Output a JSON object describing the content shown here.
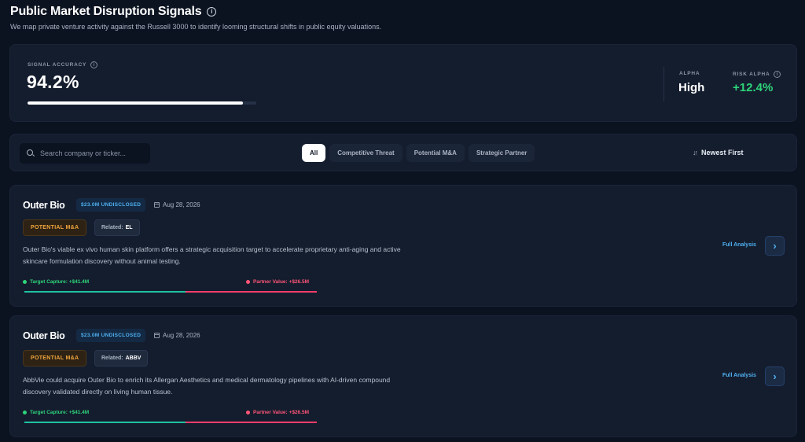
{
  "header": {
    "title": "Public Market Disruption Signals",
    "subtitle": "We map private venture activity against the Russell 3000 to identify looming structural shifts in public equity valuations."
  },
  "stats": {
    "accuracy_label": "SIGNAL ACCURACY",
    "accuracy_value": "94.2%",
    "accuracy_fraction": 0.942,
    "alpha_label": "ALPHA",
    "alpha_value": "High",
    "risk_alpha_label": "RISK ALPHA",
    "risk_alpha_value": "+12.4%",
    "colors": {
      "positive": "#2ed47a"
    }
  },
  "filters": {
    "search_placeholder": "Search company or ticker...",
    "tabs": [
      {
        "label": "All",
        "active": true
      },
      {
        "label": "Competitive Threat",
        "active": false
      },
      {
        "label": "Potential M&A",
        "active": false
      },
      {
        "label": "Strategic Partner",
        "active": false
      }
    ],
    "sort_label": "Newest First",
    "sort_icon": "sort-arrows-icon"
  },
  "signals": [
    {
      "company": "Outer Bio",
      "funding": "$23.0M UNDISCLOSED",
      "date": "Aug 28, 2026",
      "type": "POTENTIAL M&A",
      "related_prefix": "Related:",
      "related_ticker": "EL",
      "description": "Outer Bio's viable ex vivo human skin platform offers a strategic acquisition target to accelerate proprietary anti-aging and active skincare formulation discovery without animal testing.",
      "target_capture": "Target Capture: +$41.4M",
      "partner_value": "Partner Value: +$26.5M",
      "capture_share": 0.55,
      "analysis_label": "Full Analysis"
    },
    {
      "company": "Outer Bio",
      "funding": "$23.0M UNDISCLOSED",
      "date": "Aug 28, 2026",
      "type": "POTENTIAL M&A",
      "related_prefix": "Related:",
      "related_ticker": "ABBV",
      "description": "AbbVie could acquire Outer Bio to enrich its Allergan Aesthetics and medical dermatology pipelines with AI-driven compound discovery validated directly on living human tissue.",
      "target_capture": "Target Capture: +$41.4M",
      "partner_value": "Partner Value: +$26.5M",
      "capture_share": 0.55,
      "analysis_label": "Full Analysis"
    }
  ]
}
